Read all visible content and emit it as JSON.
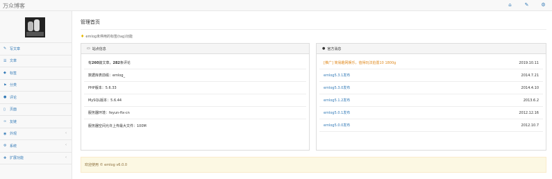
{
  "header": {
    "brand": "万众博客",
    "icons": [
      "home-icon",
      "wrench-icon",
      "gear-icon"
    ]
  },
  "sidebar": {
    "items": [
      {
        "label": "写文章",
        "icon": "pencil-icon"
      },
      {
        "label": "文章",
        "icon": "list-icon"
      },
      {
        "label": "标签",
        "icon": "tag-icon"
      },
      {
        "label": "分类",
        "icon": "flag-icon"
      },
      {
        "label": "评论",
        "icon": "comment-icon"
      },
      {
        "label": "页面",
        "icon": "file-icon"
      },
      {
        "label": "友链",
        "icon": "link-icon"
      },
      {
        "label": "外观",
        "icon": "eye-icon",
        "has_submenu": true
      },
      {
        "label": "系统",
        "icon": "gear-icon",
        "has_submenu": true
      },
      {
        "label": "扩展功能",
        "icon": "plugin-icon",
        "has_submenu": true
      }
    ]
  },
  "main": {
    "title": "管理首页",
    "tip": "emlog未停用的标签(tag)功能",
    "stats_panel": {
      "heading": "站点信息",
      "rows": [
        {
          "prefix": "有",
          "n1": "260",
          "mid": "篇文章，",
          "n2": "282",
          "suffix": "条评论"
        },
        {
          "text": "数据库表前缀：emlog_"
        },
        {
          "text": "PHP版本：5.6.33"
        },
        {
          "text": "MySQL版本：5.6.44"
        },
        {
          "text": "服务器环境：feyun-fix-cn"
        },
        {
          "text": "服务器空间允许上传最大文件：100M"
        }
      ]
    },
    "news_panel": {
      "heading": "官方消息",
      "rows": [
        {
          "title": "[推广] 简易趣网娱乐，值得玩法拍置10 1800g",
          "date": "2019.10.11",
          "highlight": true
        },
        {
          "title": "emlog5.3.1发布",
          "date": "2014.7.21",
          "highlight": false
        },
        {
          "title": "emlog5.3.0发布",
          "date": "2014.4.10",
          "highlight": false
        },
        {
          "title": "emlog5.1.2发布",
          "date": "2013.6.2",
          "highlight": false
        },
        {
          "title": "emlog5.0.1发布",
          "date": "2012.12.16",
          "highlight": false
        },
        {
          "title": "emlog5.0.0发布",
          "date": "2012.10.7",
          "highlight": false
        }
      ]
    },
    "footer": "欢迎使用 © emlog v6.0.0"
  }
}
